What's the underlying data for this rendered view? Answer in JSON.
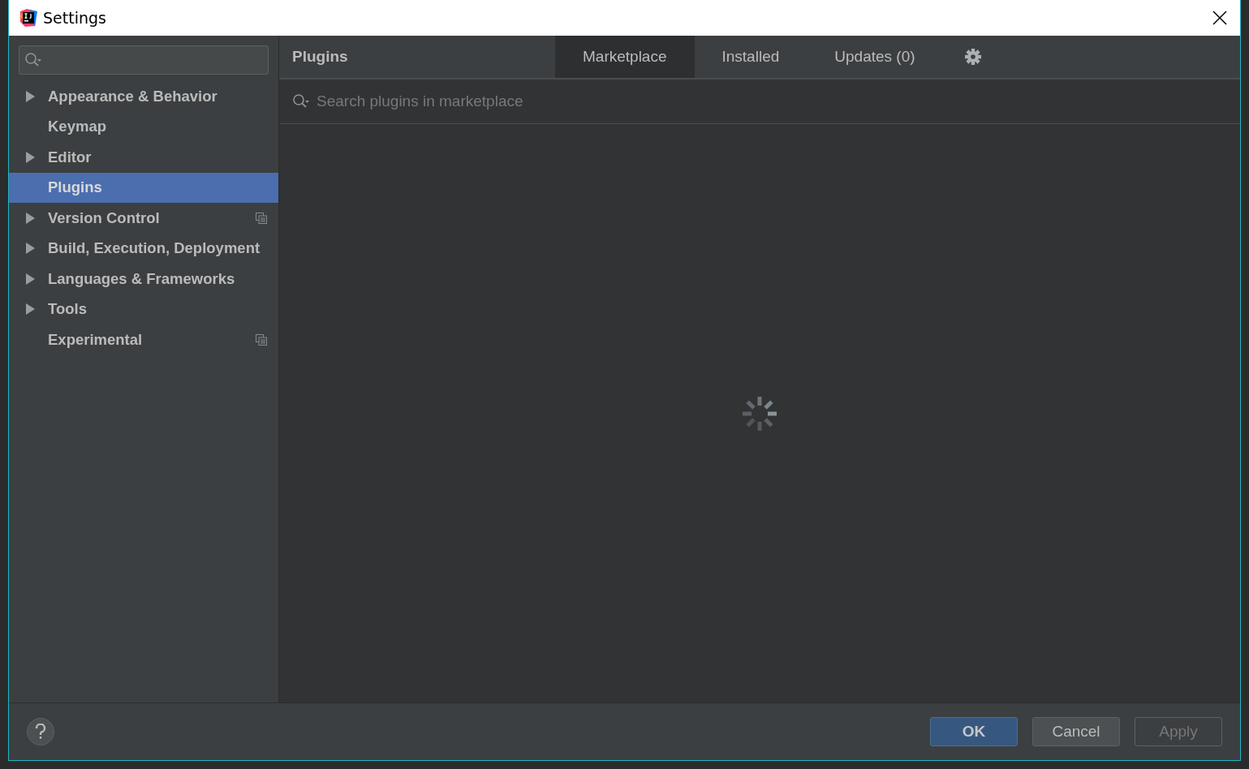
{
  "window": {
    "title": "Settings"
  },
  "sidebar": {
    "items": [
      {
        "label": "Appearance & Behavior",
        "expanded": false,
        "selected": false,
        "project_level": false
      },
      {
        "label": "Keymap",
        "selected": false,
        "project_level": false
      },
      {
        "label": "Editor",
        "expanded": false,
        "selected": false,
        "project_level": false
      },
      {
        "label": "Plugins",
        "selected": true,
        "project_level": false
      },
      {
        "label": "Version Control",
        "expanded": false,
        "selected": false,
        "project_level": true
      },
      {
        "label": "Build, Execution, Deployment",
        "expanded": false,
        "selected": false,
        "project_level": false
      },
      {
        "label": "Languages & Frameworks",
        "expanded": false,
        "selected": false,
        "project_level": false
      },
      {
        "label": "Tools",
        "expanded": false,
        "selected": false,
        "project_level": false
      },
      {
        "label": "Experimental",
        "selected": false,
        "project_level": true
      }
    ]
  },
  "panel": {
    "title": "Plugins",
    "tabs": [
      {
        "label": "Marketplace",
        "selected": true
      },
      {
        "label": "Installed",
        "selected": false
      },
      {
        "label": "Updates (0)",
        "selected": false
      }
    ],
    "search": {
      "placeholder": "Search plugins in marketplace"
    },
    "loading": true
  },
  "buttons": [
    {
      "label": "OK",
      "kind": "default",
      "disabled": false
    },
    {
      "label": "Cancel",
      "kind": "normal",
      "disabled": false
    },
    {
      "label": "Apply",
      "kind": "normal",
      "disabled": true
    }
  ]
}
